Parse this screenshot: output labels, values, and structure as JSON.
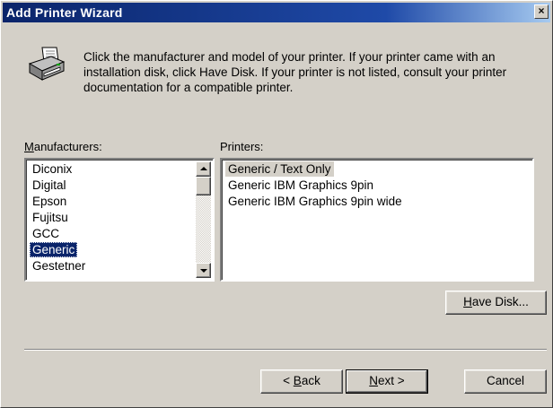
{
  "window": {
    "title": "Add Printer Wizard",
    "close_glyph": "×"
  },
  "instructions": "Click the manufacturer and model of your printer.  If your printer came with an installation disk, click Have Disk.  If your printer is not listed, consult your printer documentation for a compatible printer.",
  "manufacturers": {
    "label_accel": "M",
    "label_rest": "anufacturers:",
    "items": [
      "Diconix",
      "Digital",
      "Epson",
      "Fujitsu",
      "GCC",
      "Generic",
      "Gestetner"
    ],
    "selected": "Generic"
  },
  "printers": {
    "label": "Printers:",
    "items": [
      "Generic / Text Only",
      "Generic IBM Graphics 9pin",
      "Generic IBM Graphics 9pin wide"
    ],
    "selected": "Generic / Text Only"
  },
  "buttons": {
    "have_disk_accel": "H",
    "have_disk_rest": "ave Disk...",
    "back_prefix": "< ",
    "back_accel": "B",
    "back_rest": "ack",
    "next_accel": "N",
    "next_rest": "ext >",
    "cancel": "Cancel"
  },
  "icons": {
    "printer": "printer-icon",
    "scroll_up": "arrow-up-icon",
    "scroll_down": "arrow-down-icon",
    "close": "close-icon"
  },
  "colors": {
    "titlebar": "#0a246a",
    "selection": "#0a246a",
    "face": "#d4d0c8"
  }
}
